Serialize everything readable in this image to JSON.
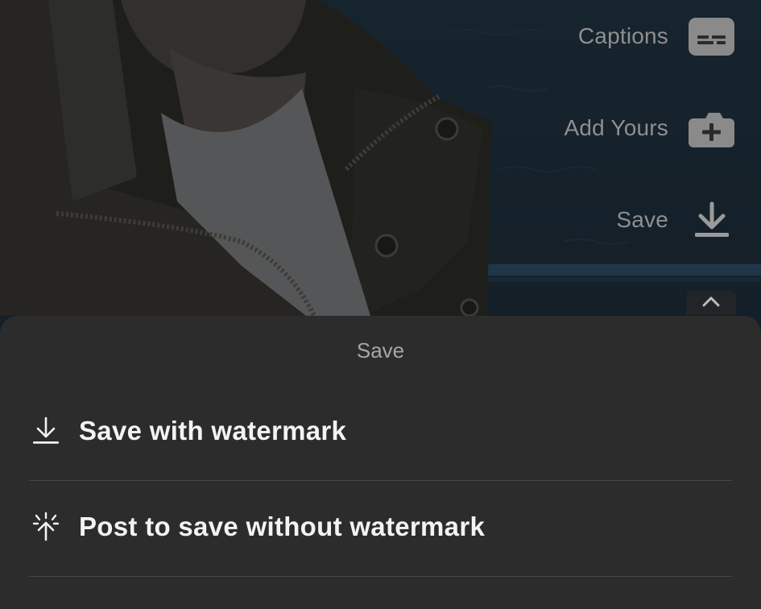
{
  "rail": {
    "captions": {
      "label": "Captions",
      "icon": "captions-icon"
    },
    "add_yours": {
      "label": "Add Yours",
      "icon": "plus-box-icon"
    },
    "save": {
      "label": "Save",
      "icon": "download-icon"
    },
    "collapse": {
      "icon": "chevron-up-icon"
    }
  },
  "sheet": {
    "title": "Save",
    "options": [
      {
        "label": "Save with watermark",
        "icon": "download-icon"
      },
      {
        "label": "Post to save without watermark",
        "icon": "sparkle-upload-icon"
      }
    ]
  },
  "colors": {
    "sheet_background": "#2c2c2c",
    "rail_text": "#8f8f8f",
    "option_text": "#f3f3f3"
  }
}
